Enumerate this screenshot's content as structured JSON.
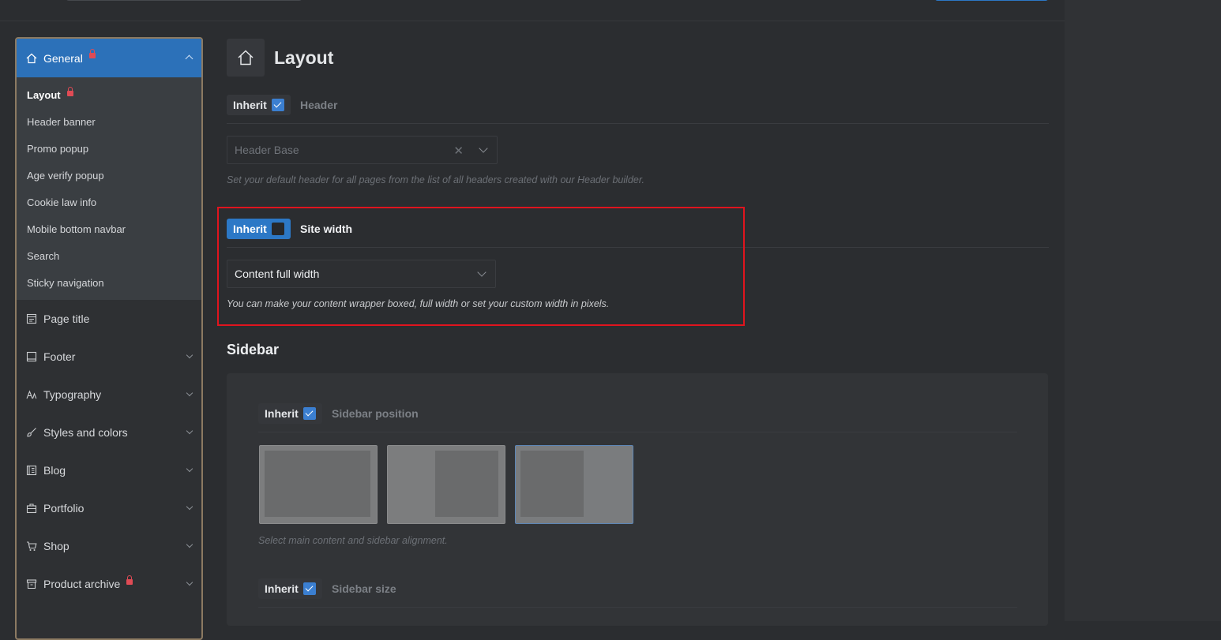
{
  "sidebar": {
    "general": {
      "label": "General"
    },
    "sub_items": [
      {
        "label": "Layout"
      },
      {
        "label": "Header banner"
      },
      {
        "label": "Promo popup"
      },
      {
        "label": "Age verify popup"
      },
      {
        "label": "Cookie law info"
      },
      {
        "label": "Mobile bottom navbar"
      },
      {
        "label": "Search"
      },
      {
        "label": "Sticky navigation"
      }
    ],
    "items": [
      {
        "label": "Page title",
        "icon": "page-icon"
      },
      {
        "label": "Footer",
        "icon": "footer-icon"
      },
      {
        "label": "Typography",
        "icon": "typography-icon"
      },
      {
        "label": "Styles and colors",
        "icon": "brush-icon"
      },
      {
        "label": "Blog",
        "icon": "blog-icon"
      },
      {
        "label": "Portfolio",
        "icon": "briefcase-icon"
      },
      {
        "label": "Shop",
        "icon": "cart-icon"
      },
      {
        "label": "Product archive",
        "icon": "archive-icon"
      }
    ]
  },
  "main": {
    "title": "Layout",
    "header_option": {
      "inherit_label": "Inherit",
      "label": "Header",
      "select_value": "Header Base",
      "description": "Set your default header for all pages from the list of all headers created with our Header builder."
    },
    "site_width": {
      "inherit_label": "Inherit",
      "label": "Site width",
      "select_value": "Content full width",
      "description": "You can make your content wrapper boxed, full width or set your custom width in pixels."
    },
    "sidebar_section": {
      "title": "Sidebar",
      "position": {
        "inherit_label": "Inherit",
        "label": "Sidebar position",
        "description": "Select main content and sidebar alignment."
      },
      "size": {
        "inherit_label": "Inherit",
        "label": "Sidebar size"
      }
    }
  },
  "colors": {
    "accent": "#2c78c6",
    "highlight": "#e0141e",
    "lock": "#e04b55"
  }
}
